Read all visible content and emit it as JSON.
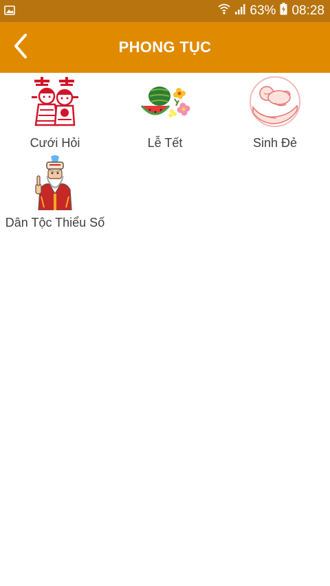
{
  "status_bar": {
    "battery_percent": "63%",
    "time": "08:28",
    "icons": [
      "image-notification-icon",
      "wifi-icon",
      "signal-icon",
      "battery-charging-icon"
    ],
    "background_color": "#b8740f"
  },
  "app_bar": {
    "title": "PHONG TỤC",
    "back_icon": "chevron-left-icon",
    "background_color": "#e08a00"
  },
  "categories": [
    {
      "label": "Cưới Hỏi",
      "icon": "wedding-couple-icon"
    },
    {
      "label": "Lễ Tết",
      "icon": "watermelon-flowers-icon"
    },
    {
      "label": "Sinh Đẻ",
      "icon": "baby-in-hands-icon"
    },
    {
      "label": "Dân Tộc Thiểu Số",
      "icon": "ethnic-elder-icon"
    }
  ]
}
